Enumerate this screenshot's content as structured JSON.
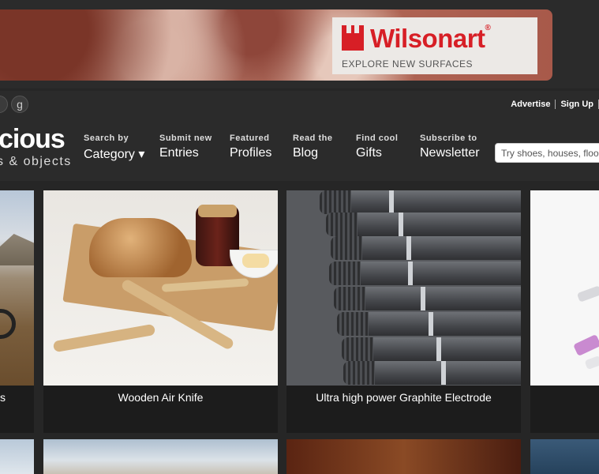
{
  "ad": {
    "brand": "Wilsonart",
    "trademark": "®",
    "tagline": "EXPLORE NEW SURFACES"
  },
  "topbar": {
    "social_icons": [
      {
        "name": "partial-social-icon",
        "glyph": ""
      },
      {
        "name": "google-plus-icon",
        "glyph": "g"
      }
    ],
    "links": [
      "Advertise",
      "Sign Up"
    ]
  },
  "header": {
    "logo_text": "cious",
    "logo_sub": "s & objects",
    "nav": [
      {
        "small": "Search by",
        "big": "Category ▾"
      },
      {
        "small": "Submit new",
        "big": "Entries"
      },
      {
        "small": "Featured",
        "big": "Profiles"
      },
      {
        "small": "Read the",
        "big": "Blog"
      },
      {
        "small": "Find cool",
        "big": "Gifts"
      },
      {
        "small": "Subscribe to",
        "big": "Newsletter"
      }
    ],
    "search_placeholder": "Try shoes, houses, floors"
  },
  "cards": [
    {
      "title": "s"
    },
    {
      "title": "Wooden Air Knife"
    },
    {
      "title": "Ultra high power Graphite Electrode"
    },
    {
      "title": ""
    }
  ],
  "colors": {
    "background": "#262626",
    "header": "#2b2b2b",
    "brand_red": "#d71f26"
  }
}
